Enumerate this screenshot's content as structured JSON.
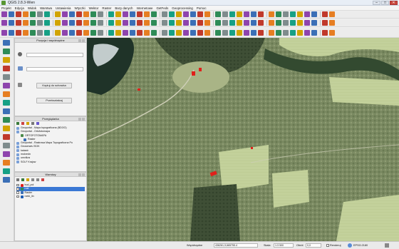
{
  "window": {
    "title": "QGIS 2.8.3-Wien"
  },
  "menu": [
    "Projekt",
    "Edycja",
    "Widok",
    "Warstwa",
    "Ustawienia",
    "Wtyczki",
    "Wektor",
    "Raster",
    "Bazy danych",
    "Internetowe",
    "GetFeds",
    "Geoprocessing",
    "Pomoc"
  ],
  "coords_panel": {
    "title": "Pozycja i współrzędne",
    "copy_button": "Kopiuj do schowka",
    "transform_button": "Przekształcaj"
  },
  "layers_panel": {
    "title": "Przeglądarka",
    "items": [
      "Geoportal - Mapa topograficzna (BDOO)",
      "Geoportal - Ortofotomapa",
      "ORTOFOTOMAPA",
      "Raster",
      "Geoportal - Rastrowa Mapa Topograficzna Po",
      "Geoserwis ISOK",
      "katastr",
      "mokredn",
      "umviliza",
      "SOLF Krajow"
    ]
  },
  "legend_panel": {
    "title": "Warstwy",
    "items": [
      "bud_pol",
      "rosl",
      "Raster",
      "rzeki_lin"
    ]
  },
  "statusbar": {
    "coord_label": "Współrzędne",
    "coord_value": "436261,9,665755.4",
    "scale_label": "Skala",
    "scale_value": "1:3 500",
    "rotation_label": "Obrót",
    "rotation_value": "0,0",
    "render_label": "Renderuj",
    "crs": "EPSG:2180"
  },
  "colors": {
    "selection": "#3a78d4",
    "map_forest": "#7a8a63",
    "map_field": "#c5d29b",
    "map_water": "#263b2d",
    "feature_red": "#e0201a"
  }
}
